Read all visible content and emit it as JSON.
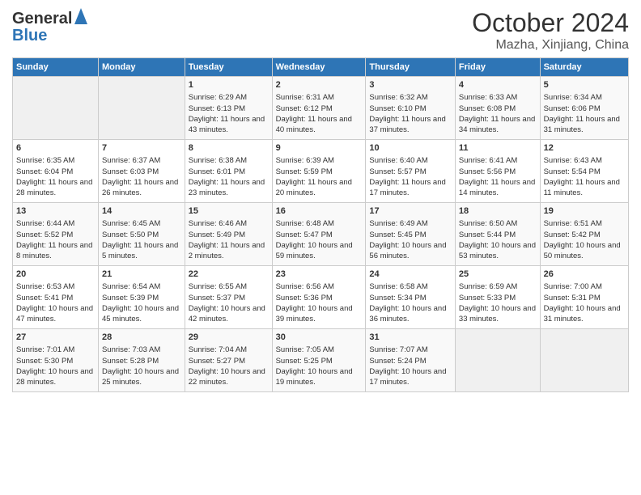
{
  "logo": {
    "line1": "General",
    "line2": "Blue"
  },
  "title": "October 2024",
  "subtitle": "Mazha, Xinjiang, China",
  "headers": [
    "Sunday",
    "Monday",
    "Tuesday",
    "Wednesday",
    "Thursday",
    "Friday",
    "Saturday"
  ],
  "weeks": [
    [
      {
        "day": "",
        "data": ""
      },
      {
        "day": "",
        "data": ""
      },
      {
        "day": "1",
        "data": "Sunrise: 6:29 AM\nSunset: 6:13 PM\nDaylight: 11 hours and 43 minutes."
      },
      {
        "day": "2",
        "data": "Sunrise: 6:31 AM\nSunset: 6:12 PM\nDaylight: 11 hours and 40 minutes."
      },
      {
        "day": "3",
        "data": "Sunrise: 6:32 AM\nSunset: 6:10 PM\nDaylight: 11 hours and 37 minutes."
      },
      {
        "day": "4",
        "data": "Sunrise: 6:33 AM\nSunset: 6:08 PM\nDaylight: 11 hours and 34 minutes."
      },
      {
        "day": "5",
        "data": "Sunrise: 6:34 AM\nSunset: 6:06 PM\nDaylight: 11 hours and 31 minutes."
      }
    ],
    [
      {
        "day": "6",
        "data": "Sunrise: 6:35 AM\nSunset: 6:04 PM\nDaylight: 11 hours and 28 minutes."
      },
      {
        "day": "7",
        "data": "Sunrise: 6:37 AM\nSunset: 6:03 PM\nDaylight: 11 hours and 26 minutes."
      },
      {
        "day": "8",
        "data": "Sunrise: 6:38 AM\nSunset: 6:01 PM\nDaylight: 11 hours and 23 minutes."
      },
      {
        "day": "9",
        "data": "Sunrise: 6:39 AM\nSunset: 5:59 PM\nDaylight: 11 hours and 20 minutes."
      },
      {
        "day": "10",
        "data": "Sunrise: 6:40 AM\nSunset: 5:57 PM\nDaylight: 11 hours and 17 minutes."
      },
      {
        "day": "11",
        "data": "Sunrise: 6:41 AM\nSunset: 5:56 PM\nDaylight: 11 hours and 14 minutes."
      },
      {
        "day": "12",
        "data": "Sunrise: 6:43 AM\nSunset: 5:54 PM\nDaylight: 11 hours and 11 minutes."
      }
    ],
    [
      {
        "day": "13",
        "data": "Sunrise: 6:44 AM\nSunset: 5:52 PM\nDaylight: 11 hours and 8 minutes."
      },
      {
        "day": "14",
        "data": "Sunrise: 6:45 AM\nSunset: 5:50 PM\nDaylight: 11 hours and 5 minutes."
      },
      {
        "day": "15",
        "data": "Sunrise: 6:46 AM\nSunset: 5:49 PM\nDaylight: 11 hours and 2 minutes."
      },
      {
        "day": "16",
        "data": "Sunrise: 6:48 AM\nSunset: 5:47 PM\nDaylight: 10 hours and 59 minutes."
      },
      {
        "day": "17",
        "data": "Sunrise: 6:49 AM\nSunset: 5:45 PM\nDaylight: 10 hours and 56 minutes."
      },
      {
        "day": "18",
        "data": "Sunrise: 6:50 AM\nSunset: 5:44 PM\nDaylight: 10 hours and 53 minutes."
      },
      {
        "day": "19",
        "data": "Sunrise: 6:51 AM\nSunset: 5:42 PM\nDaylight: 10 hours and 50 minutes."
      }
    ],
    [
      {
        "day": "20",
        "data": "Sunrise: 6:53 AM\nSunset: 5:41 PM\nDaylight: 10 hours and 47 minutes."
      },
      {
        "day": "21",
        "data": "Sunrise: 6:54 AM\nSunset: 5:39 PM\nDaylight: 10 hours and 45 minutes."
      },
      {
        "day": "22",
        "data": "Sunrise: 6:55 AM\nSunset: 5:37 PM\nDaylight: 10 hours and 42 minutes."
      },
      {
        "day": "23",
        "data": "Sunrise: 6:56 AM\nSunset: 5:36 PM\nDaylight: 10 hours and 39 minutes."
      },
      {
        "day": "24",
        "data": "Sunrise: 6:58 AM\nSunset: 5:34 PM\nDaylight: 10 hours and 36 minutes."
      },
      {
        "day": "25",
        "data": "Sunrise: 6:59 AM\nSunset: 5:33 PM\nDaylight: 10 hours and 33 minutes."
      },
      {
        "day": "26",
        "data": "Sunrise: 7:00 AM\nSunset: 5:31 PM\nDaylight: 10 hours and 31 minutes."
      }
    ],
    [
      {
        "day": "27",
        "data": "Sunrise: 7:01 AM\nSunset: 5:30 PM\nDaylight: 10 hours and 28 minutes."
      },
      {
        "day": "28",
        "data": "Sunrise: 7:03 AM\nSunset: 5:28 PM\nDaylight: 10 hours and 25 minutes."
      },
      {
        "day": "29",
        "data": "Sunrise: 7:04 AM\nSunset: 5:27 PM\nDaylight: 10 hours and 22 minutes."
      },
      {
        "day": "30",
        "data": "Sunrise: 7:05 AM\nSunset: 5:25 PM\nDaylight: 10 hours and 19 minutes."
      },
      {
        "day": "31",
        "data": "Sunrise: 7:07 AM\nSunset: 5:24 PM\nDaylight: 10 hours and 17 minutes."
      },
      {
        "day": "",
        "data": ""
      },
      {
        "day": "",
        "data": ""
      }
    ]
  ]
}
